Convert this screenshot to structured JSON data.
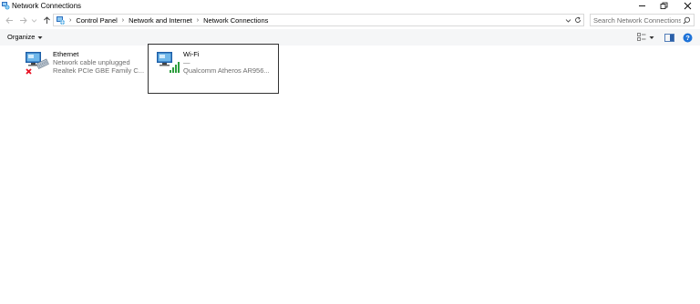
{
  "window": {
    "title": "Network Connections",
    "icon": "network-connections-icon"
  },
  "address": {
    "crumbs": [
      "Control Panel",
      "Network and Internet",
      "Network Connections"
    ],
    "search_placeholder": "Search Network Connections"
  },
  "toolbar": {
    "organize_label": "Organize"
  },
  "connections": [
    {
      "name": "Ethernet",
      "status": "Network cable unplugged",
      "device": "Realtek PCIe GBE Family C...",
      "icon": "ethernet-adapter-icon",
      "state": "disconnected"
    },
    {
      "name": "Wi-Fi",
      "status": "—",
      "device": "Qualcomm Atheros AR956...",
      "icon": "wifi-adapter-icon",
      "state": "connected",
      "selected": true
    }
  ],
  "colors": {
    "accent": "#1a73c9",
    "error_red": "#e81123",
    "signal_green": "#2e9e3e",
    "selection_border": "#333333",
    "help_blue": "#1e73d8"
  }
}
